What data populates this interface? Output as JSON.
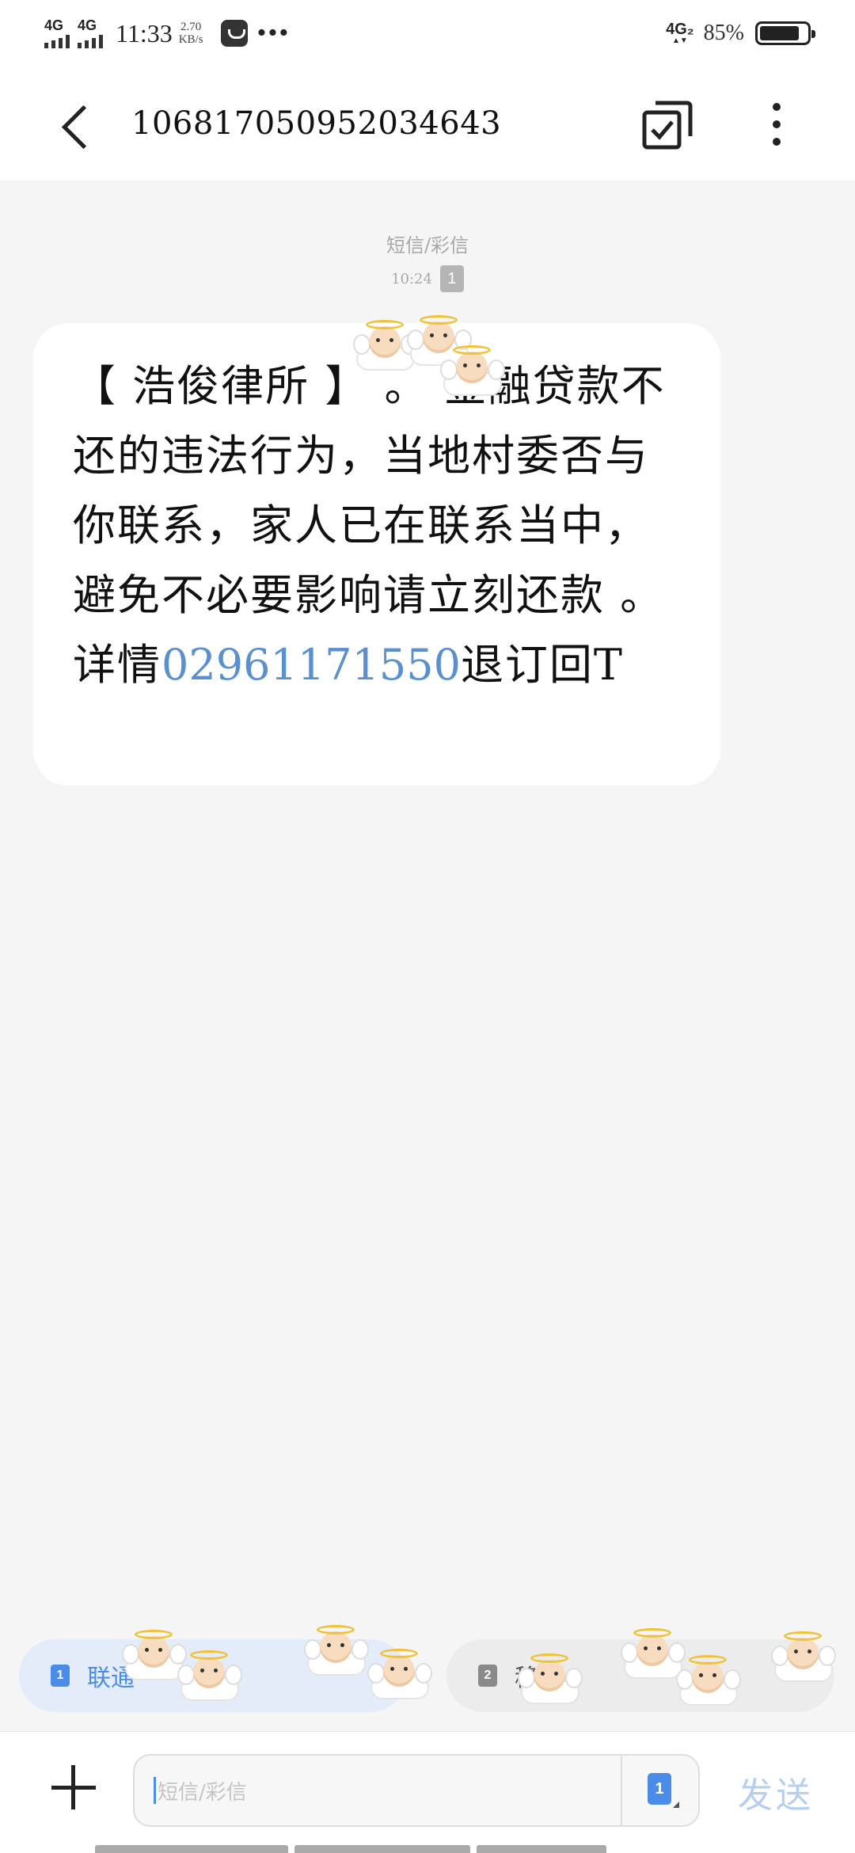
{
  "status_bar": {
    "network_1": "4G",
    "network_2": "4G",
    "time": "11:33",
    "speed_value": "2.70",
    "speed_unit": "KB/s",
    "more_indicator": "•••",
    "network_right": "4G₂",
    "network_right_arrows": "▲▼",
    "battery_text": "85%",
    "battery_level": 0.85
  },
  "header": {
    "contact_number": "106817050952034643",
    "back_icon": "chevron-left-icon",
    "multi_select_icon": "checkbox-stack-icon",
    "more_icon": "vertical-dots-icon"
  },
  "message_meta": {
    "type": "短信/彩信",
    "time": "10:24",
    "sim": "1"
  },
  "message": {
    "text_before": "【 浩俊律所 】 。 金融贷款不还的违法行为，当地村委否与你联系，家人已在联系当中，避免不必要影响请立刻还款 。详情",
    "link": "02961171550",
    "text_after": "退订回T"
  },
  "sim_selector": {
    "sim1": {
      "badge": "1",
      "label": "联通"
    },
    "sim2": {
      "badge": "2",
      "label": "移"
    },
    "accent": "#4a8ce8"
  },
  "compose": {
    "add_icon": "plus-icon",
    "placeholder": "短信/彩信",
    "sim_badge": "1",
    "send_label": "发送"
  }
}
